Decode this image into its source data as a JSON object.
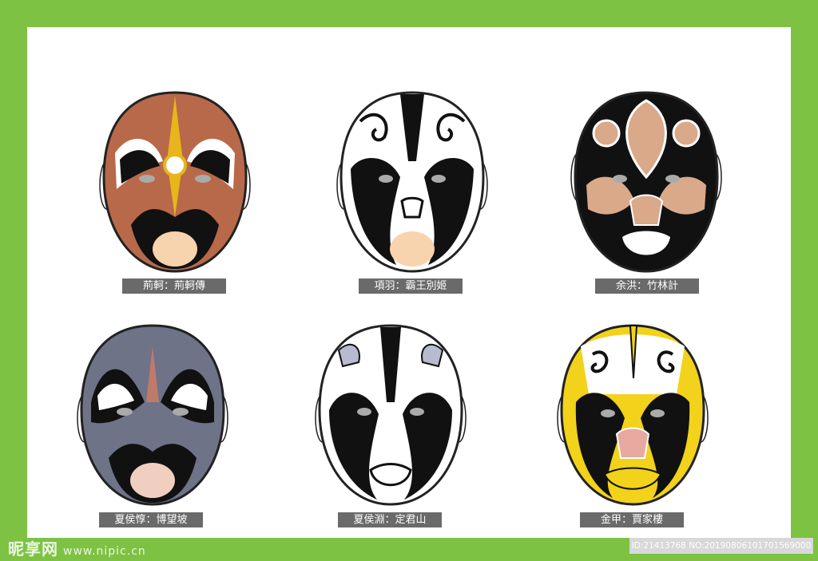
{
  "masks": [
    {
      "caption": "荊軻：荊軻傳",
      "base": "#b8694a",
      "pattern": "jingke"
    },
    {
      "caption": "項羽：霸王別姬",
      "base": "#ffffff",
      "pattern": "xiangyu"
    },
    {
      "caption": "余洪：竹林計",
      "base": "#d9a98a",
      "pattern": "yuhong"
    },
    {
      "caption": "夏侯惇：博望坡",
      "base": "#6e7388",
      "pattern": "xiahoudun"
    },
    {
      "caption": "夏侯淵：定君山",
      "base": "#ffffff",
      "pattern": "xiahouyuan"
    },
    {
      "caption": "金甲：賈家樓",
      "base": "#f2d21a",
      "pattern": "jinjia"
    }
  ],
  "watermark": {
    "brand": "昵享网",
    "url": "www.nipic.cn"
  },
  "image_id": "ID:21413768 NO:20190806101701569000"
}
